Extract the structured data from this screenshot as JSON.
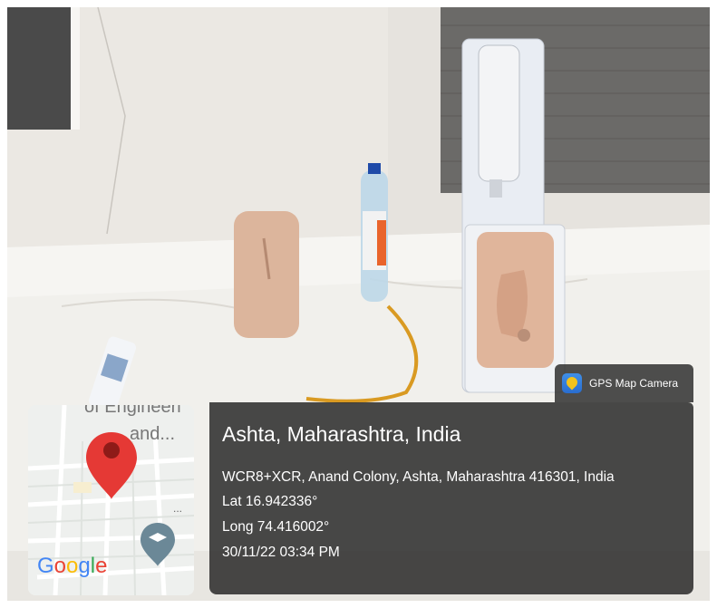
{
  "badge": {
    "label": "GPS Map Camera",
    "icon": "gps-map-camera-icon"
  },
  "map": {
    "place_label_top": "of Engineeri",
    "place_label_bottom": "and...",
    "dots": "...",
    "brand": "Google",
    "brand_colors": [
      "#4285F4",
      "#EA4335",
      "#FBBC05",
      "#4285F4",
      "#34A853",
      "#EA4335"
    ]
  },
  "location": {
    "title": "Ashta, Maharashtra, India",
    "address": "WCR8+XCR, Anand Colony, Ashta, Maharashtra 416301, India",
    "lat": "Lat 16.942336°",
    "long": "Long 74.416002°",
    "datetime": "30/11/22 03:34 PM"
  }
}
